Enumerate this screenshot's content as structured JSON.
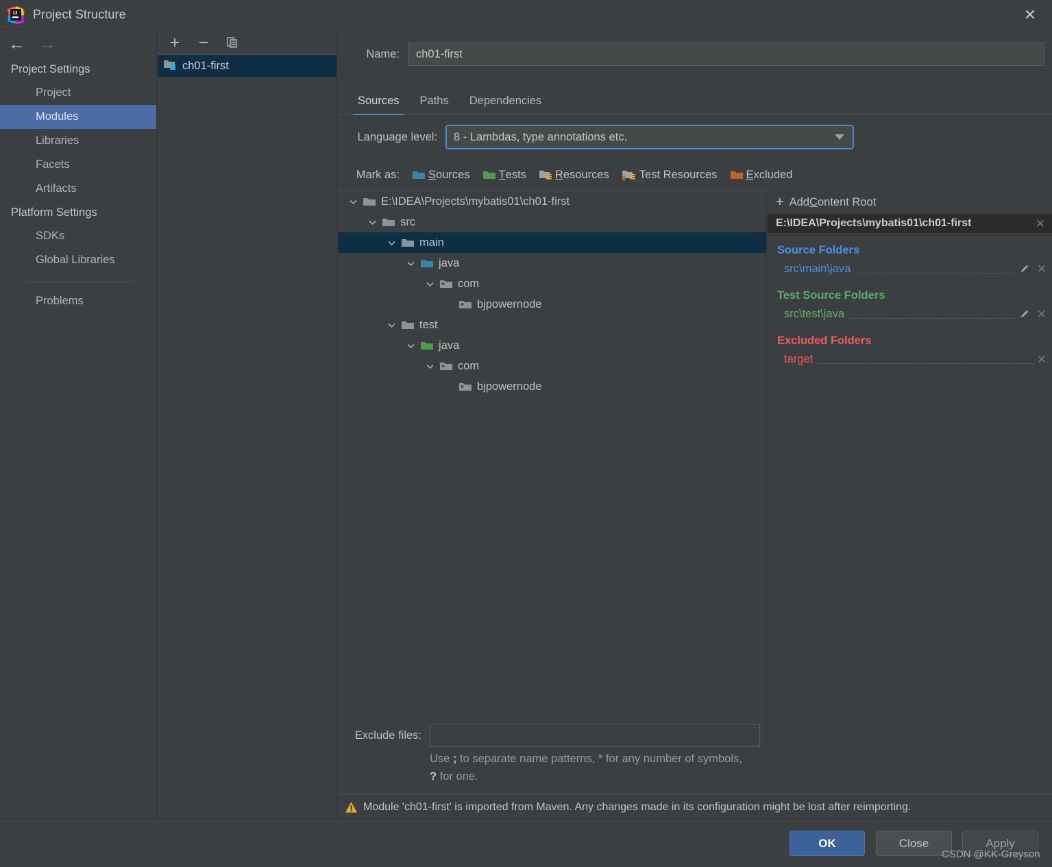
{
  "window": {
    "title": "Project Structure",
    "app_icon": "intellij-idea-icon",
    "close_label": "✕"
  },
  "sidebar": {
    "back_arrow": "←",
    "forward_arrow": "→",
    "groups": [
      {
        "header": "Project Settings",
        "items": [
          {
            "label": "Project",
            "selected": false
          },
          {
            "label": "Modules",
            "selected": true
          },
          {
            "label": "Libraries",
            "selected": false
          },
          {
            "label": "Facets",
            "selected": false
          },
          {
            "label": "Artifacts",
            "selected": false
          }
        ]
      },
      {
        "header": "Platform Settings",
        "items": [
          {
            "label": "SDKs",
            "selected": false
          },
          {
            "label": "Global Libraries",
            "selected": false
          }
        ]
      }
    ],
    "problems_label": "Problems",
    "help_label": "?"
  },
  "modules_panel": {
    "toolbar": {
      "add_label": "+",
      "remove_label": "−",
      "copy_label": "copy-icon"
    },
    "items": [
      {
        "label": "ch01-first",
        "selected": true,
        "icon": "module-folder-icon"
      }
    ]
  },
  "main": {
    "name_label": "Name:",
    "name_value": "ch01-first",
    "tabs": [
      {
        "label": "Sources",
        "active": true
      },
      {
        "label": "Paths",
        "active": false
      },
      {
        "label": "Dependencies",
        "active": false
      }
    ],
    "language_level_label": "Language level:",
    "language_level_value": "8 - Lambdas, type annotations etc.",
    "mark_as_label": "Mark as:",
    "mark_as_options": [
      {
        "label": "Sources",
        "mnemonic": "S",
        "rest": "ources",
        "icon": "folder-blue-icon",
        "color": "#3b83a8"
      },
      {
        "label": "Tests",
        "mnemonic": "T",
        "rest": "ests",
        "icon": "folder-green-icon",
        "color": "#4f9a4f"
      },
      {
        "label": "Resources",
        "mnemonic": "R",
        "rest": "esources",
        "icon": "folder-resources-icon",
        "color": "#9ea2a4"
      },
      {
        "label": "Test Resources",
        "mnemonic": "",
        "rest": "Test Resources",
        "icon": "folder-test-resources-icon",
        "color": "#9ea2a4"
      },
      {
        "label": "Excluded",
        "mnemonic": "E",
        "rest": "xcluded",
        "icon": "folder-orange-icon",
        "color": "#c1642a"
      }
    ],
    "tree": [
      {
        "label": "E:\\IDEA\\Projects\\mybatis01\\ch01-first",
        "depth": 0,
        "expanded": true,
        "icon": "folder-grey-icon",
        "selected": false
      },
      {
        "label": "src",
        "depth": 1,
        "expanded": true,
        "icon": "folder-grey-icon",
        "selected": false
      },
      {
        "label": "main",
        "depth": 2,
        "expanded": true,
        "icon": "folder-grey-icon",
        "selected": true
      },
      {
        "label": "java",
        "depth": 3,
        "expanded": true,
        "icon": "folder-blue-icon",
        "selected": false
      },
      {
        "label": "com",
        "depth": 4,
        "expanded": true,
        "icon": "folder-package-icon",
        "selected": false
      },
      {
        "label": "bjpowernode",
        "depth": 5,
        "expanded": null,
        "icon": "folder-package-icon",
        "selected": false
      },
      {
        "label": "test",
        "depth": 2,
        "expanded": true,
        "icon": "folder-grey-icon",
        "selected": false
      },
      {
        "label": "java",
        "depth": 3,
        "expanded": true,
        "icon": "folder-green-icon",
        "selected": false
      },
      {
        "label": "com",
        "depth": 4,
        "expanded": true,
        "icon": "folder-package-icon",
        "selected": false
      },
      {
        "label": "bjpowernode",
        "depth": 5,
        "expanded": null,
        "icon": "folder-package-icon",
        "selected": false
      }
    ],
    "exclude_files_label": "Exclude files:",
    "exclude_files_value": "",
    "exclude_hint_part1": "Use ",
    "exclude_hint_semicolon": ";",
    "exclude_hint_part2": " to separate name patterns, * for any number of symbols, ",
    "exclude_hint_question": "?",
    "exclude_hint_part3": " for one.",
    "warning_text": "Module 'ch01-first' is imported from Maven. Any changes made in its configuration might be lost after reimporting.",
    "warning_icon": "warning-triangle-icon"
  },
  "right_panel": {
    "add_content_root_label_prefix": "Add ",
    "add_content_root_mnemonic": "C",
    "add_content_root_label_suffix": "ontent Root",
    "content_root": "E:\\IDEA\\Projects\\mybatis01\\ch01-first",
    "groups": [
      {
        "title": "Source Folders",
        "kind": "src",
        "folders": [
          {
            "path": "src\\main\\java",
            "has_edit": true,
            "has_remove": true
          }
        ]
      },
      {
        "title": "Test Source Folders",
        "kind": "test",
        "folders": [
          {
            "path": "src\\test\\java",
            "has_edit": true,
            "has_remove": true
          }
        ]
      },
      {
        "title": "Excluded Folders",
        "kind": "excl",
        "folders": [
          {
            "path": "target",
            "has_edit": false,
            "has_remove": true
          }
        ]
      }
    ],
    "remove_label": "✕"
  },
  "footer": {
    "ok_label": "OK",
    "close_label": "Close",
    "apply_label": "Apply",
    "watermark": "CSDN @KK-Greyson"
  },
  "colors": {
    "background": "#3c3f41",
    "selection_blue": "#4a6da7",
    "tree_selection": "#0d2e44",
    "accent_tab": "#4a88c7",
    "source_blue": "#4d8ee0",
    "test_green": "#5fad65",
    "excluded_red": "#f05a5a",
    "ok_button": "#3c6098"
  }
}
